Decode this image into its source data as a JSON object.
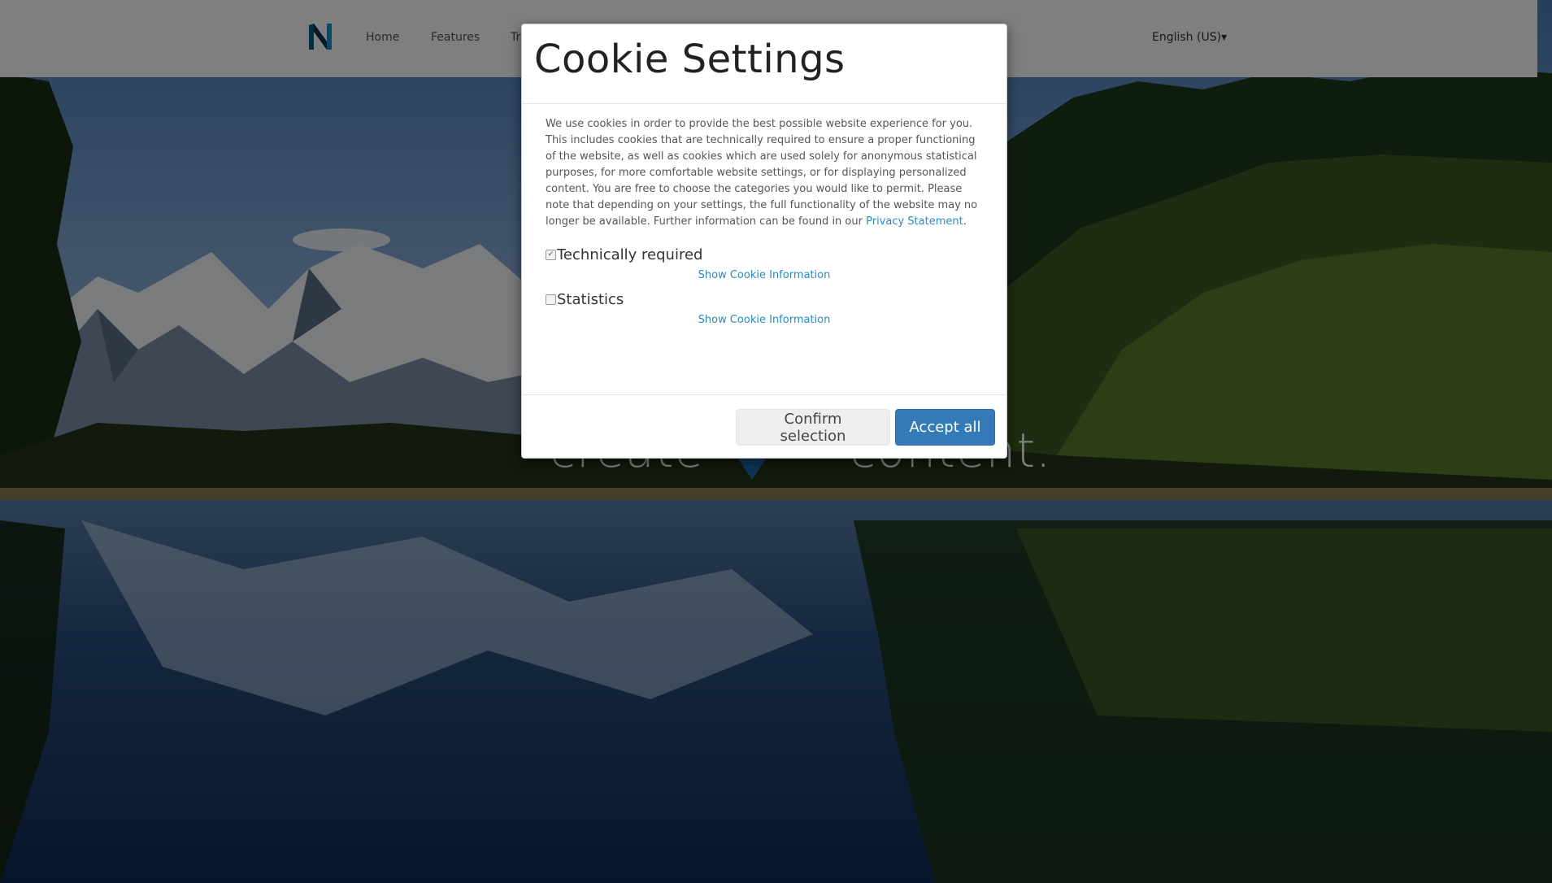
{
  "header": {
    "logo_letter": "N",
    "nav": [
      "Home",
      "Features",
      "Tr"
    ],
    "language": "English (US)",
    "language_caret": "▾"
  },
  "hero": {
    "word_left": "create",
    "word_right": "content."
  },
  "modal": {
    "title": "Cookie Settings",
    "intro_text": "We use cookies in order to provide the best possible website experience for you. This includes cookies that are technically required to ensure a proper functioning of the website, as well as cookies which are used solely for anonymous statistical purposes, for more comfortable website settings, or for displaying personalized content. You are free to choose the categories you would like to permit. Please note that depending on your settings, the full functionality of the website may no longer be available. Further information can be found in our ",
    "privacy_link": "Privacy Statement",
    "intro_end": ".",
    "categories": [
      {
        "label": "Technically required",
        "checked": true,
        "info_link": "Show Cookie Information"
      },
      {
        "label": "Statistics",
        "checked": false,
        "info_link": "Show Cookie Information"
      }
    ],
    "buttons": {
      "confirm": "Confirm selection",
      "accept_all": "Accept all"
    }
  },
  "colors": {
    "link": "#2a8bc0",
    "primary_button": "#337ab7",
    "overlay": "rgba(0,0,0,0.5)"
  }
}
